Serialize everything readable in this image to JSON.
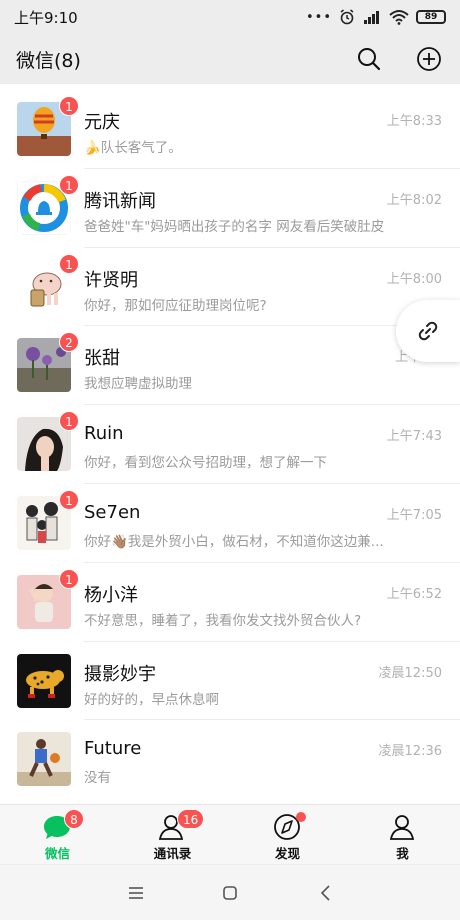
{
  "status": {
    "time": "上午9:10",
    "battery": "89"
  },
  "header": {
    "title": "微信(8)"
  },
  "chats": [
    {
      "name": "元庆",
      "preview": "🍌队长客气了。",
      "time": "上午8:33",
      "badge": "1"
    },
    {
      "name": "腾讯新闻",
      "preview": "爸爸姓\"车\"妈妈晒出孩子的名字 网友看后笑破肚皮",
      "time": "上午8:02",
      "badge": "1"
    },
    {
      "name": "许贤明",
      "preview": "你好，那如何应征助理岗位呢?",
      "time": "上午8:00",
      "badge": "1"
    },
    {
      "name": "张甜",
      "preview": "我想应聘虚拟助理",
      "time": "上午7:..",
      "badge": "2"
    },
    {
      "name": "Ruin",
      "preview": "你好，看到您公众号招助理，想了解一下",
      "time": "上午7:43",
      "badge": "1"
    },
    {
      "name": "Se7en",
      "preview": "你好👋🏽我是外贸小白，做石材，不知道你这边兼...",
      "time": "上午7:05",
      "badge": "1"
    },
    {
      "name": "杨小洋",
      "preview": "不好意思，睡着了，我看你发文找外贸合伙人?",
      "time": "上午6:52",
      "badge": "1"
    },
    {
      "name": "摄影妙宇",
      "preview": "好的好的，早点休息啊",
      "time": "凌晨12:50",
      "badge": ""
    },
    {
      "name": "Future",
      "preview": "没有",
      "time": "凌晨12:36",
      "badge": ""
    }
  ],
  "tabs": [
    {
      "label": "微信",
      "badge": "8"
    },
    {
      "label": "通讯录",
      "badge": "16"
    },
    {
      "label": "发现",
      "badge": ""
    },
    {
      "label": "我",
      "badge": ""
    }
  ],
  "colors": {
    "accent": "#07c160",
    "badge": "#fa5151",
    "header_bg": "#ededed"
  }
}
